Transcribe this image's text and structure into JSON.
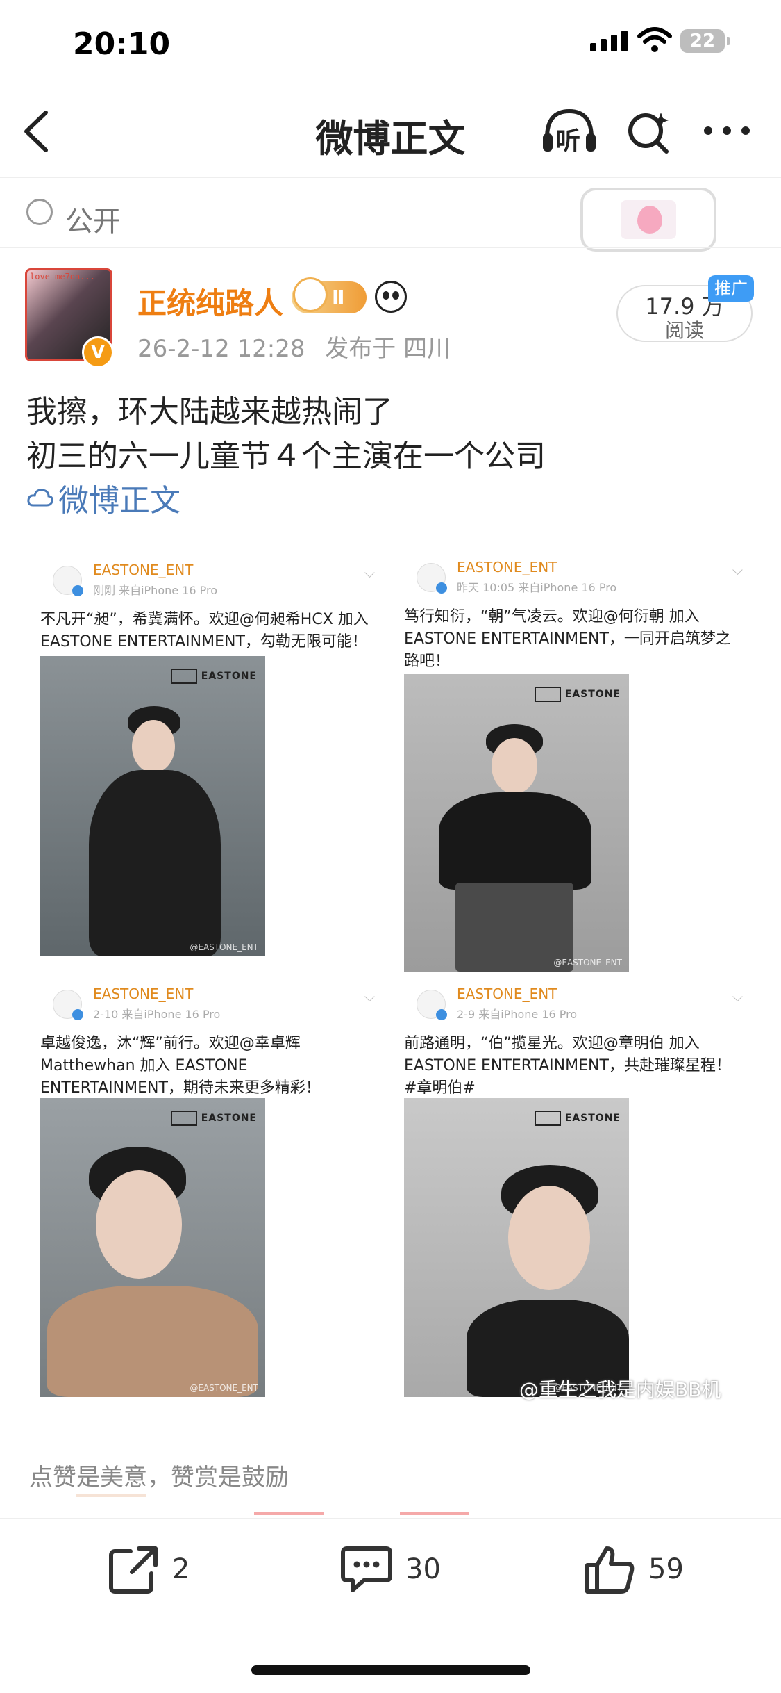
{
  "status_bar": {
    "time": "20:10",
    "battery": "22"
  },
  "header": {
    "title": "微博正文",
    "back_icon": "chevron-left-icon",
    "listen_label": "听",
    "search_icon": "search-sparkle-icon",
    "more_icon": "more-horizontal-icon"
  },
  "visibility": {
    "label": "公开",
    "icon": "globe-icon"
  },
  "author": {
    "name": "正统纯路人",
    "medal_label": "Ⅱ",
    "avatar_text": "love me7on...",
    "verified_mark": "V",
    "posted_at": "26-2-12 12:28",
    "location": "发布于 四川",
    "views_count": "17.9 万",
    "views_label": "阅读",
    "ad_tag": "推广"
  },
  "post": {
    "lines": [
      "我擦，环大陆越来越热闹了",
      "初三的六一儿童节４个主演在一个公司"
    ],
    "link_label": "微博正文"
  },
  "images": [
    {
      "account": "EASTONE_ENT",
      "meta": "刚刚 来自iPhone 16 Pro",
      "caption": "不凡开“昶”，希冀满怀。欢迎@何昶希HCX 加入 EASTONE ENTERTAINMENT，勾勒无限可能！",
      "brand": "EASTONE",
      "footer": "@EASTONE_ENT"
    },
    {
      "account": "EASTONE_ENT",
      "meta": "昨天 10:05 来自iPhone 16 Pro",
      "caption": "笃行知衍，“朝”气凌云。欢迎@何衍朝 加入 EASTONE ENTERTAINMENT，一同开启筑梦之路吧！",
      "brand": "EASTONE",
      "footer": "@EASTONE_ENT"
    },
    {
      "account": "EASTONE_ENT",
      "meta": "2-10 来自iPhone 16 Pro",
      "caption": "卓越俊逸，沐“辉”前行。欢迎@幸卓辉 Matthewhan 加入 EASTONE ENTERTAINMENT，期待未来更多精彩！",
      "brand": "EASTONE",
      "footer": "@EASTONE_ENT"
    },
    {
      "account": "EASTONE_ENT",
      "meta": "2-9 来自iPhone 16 Pro",
      "caption": "前路通明，“伯”揽星光。欢迎@章明伯 加入 EASTONE ENTERTAINMENT，共赴璀璨星程！ #章明伯#",
      "brand": "EASTONE",
      "footer": "@EASTONE_ENT"
    }
  ],
  "watermark": "@重生之我是内娱BB机",
  "footer": {
    "encourage_text": "点赞是美意，赞赏是鼓励",
    "repost_count": "2",
    "comment_count": "30",
    "like_count": "59"
  }
}
